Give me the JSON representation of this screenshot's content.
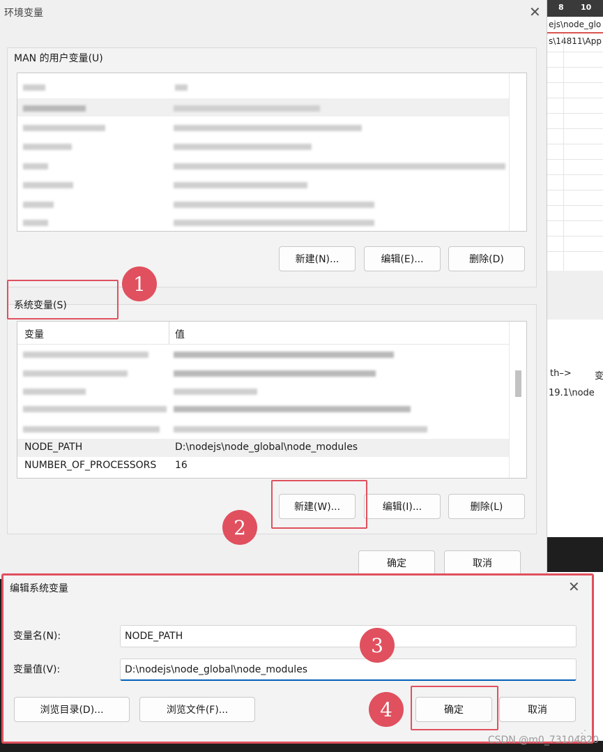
{
  "background": {
    "header_cols": [
      "8",
      "10"
    ],
    "path_lines": [
      "ejs\\node_glo",
      "s\\14811\\App"
    ],
    "fragment_arrow": "th–>",
    "fragment_char": "变",
    "fragment_path": "19.1\\node"
  },
  "env_dialog": {
    "title": "环境变量",
    "user_group_label": "MAN 的用户变量(U)",
    "user_buttons": {
      "new": "新建(N)...",
      "edit": "编辑(E)...",
      "delete": "删除(D)"
    },
    "system_group_label": "系统变量(S)",
    "columns": {
      "variable": "变量",
      "value": "值"
    },
    "system_rows": [
      {
        "name": "NODE_PATH",
        "value": "D:\\nodejs\\node_global\\node_modules"
      },
      {
        "name": "NUMBER_OF_PROCESSORS",
        "value": "16"
      }
    ],
    "system_buttons": {
      "new": "新建(W)...",
      "edit": "编辑(I)...",
      "delete": "删除(L)"
    },
    "ok": "确定",
    "cancel": "取消"
  },
  "edit_dialog": {
    "title": "编辑系统变量",
    "name_label": "变量名(N):",
    "name_value": "NODE_PATH",
    "value_label": "变量值(V):",
    "value_value": "D:\\nodejs\\node_global\\node_modules",
    "browse_dir": "浏览目录(D)...",
    "browse_file": "浏览文件(F)...",
    "ok": "确定",
    "cancel": "取消"
  },
  "annotations": [
    "1",
    "2",
    "3",
    "4"
  ],
  "watermark": "CSDN @m0_73104820",
  "icons": {
    "close": "close-icon",
    "resize": "resize-grip-icon"
  },
  "colors": {
    "annotation_red": "#e0505e",
    "accent_blue": "#005fb8"
  }
}
